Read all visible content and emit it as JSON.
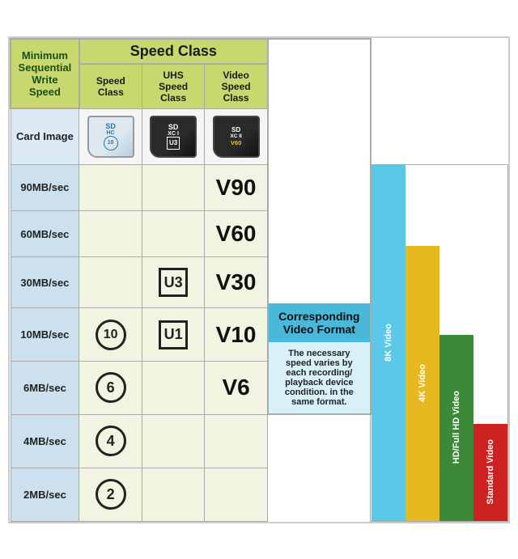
{
  "header": {
    "left_label": "Minimum\nSequential\nWrite Speed",
    "speed_class_label": "Speed Class",
    "speed_class_sub": "Speed\nClass",
    "uhs_sub": "UHS\nSpeed\nClass",
    "video_sub": "Video\nSpeed\nClass",
    "corresponding_video_format": "Corresponding Video Format",
    "video_format_desc": "The necessary speed varies by each recording/ playback device condition. in the same format."
  },
  "card_image_label": "Card Image",
  "cards": [
    {
      "label": "SDHC",
      "type": "sdhc"
    },
    {
      "label": "SDXC I",
      "type": "sdxc"
    },
    {
      "label": "SDXC II",
      "type": "sdxcii"
    }
  ],
  "rows": [
    {
      "speed": "90MB/sec",
      "class": "",
      "uhs": "",
      "video": "V90"
    },
    {
      "speed": "60MB/sec",
      "class": "",
      "uhs": "",
      "video": "V60"
    },
    {
      "speed": "30MB/sec",
      "class": "",
      "uhs": "U3",
      "video": "V30"
    },
    {
      "speed": "10MB/sec",
      "class": "C10",
      "uhs": "U1",
      "video": "V10"
    },
    {
      "speed": "6MB/sec",
      "class": "C6",
      "uhs": "",
      "video": "V6"
    },
    {
      "speed": "4MB/sec",
      "class": "C4",
      "uhs": "",
      "video": ""
    },
    {
      "speed": "2MB/sec",
      "class": "C2",
      "uhs": "",
      "video": ""
    }
  ],
  "video_bars": [
    {
      "label": "8K Video",
      "color": "#5bc8e8"
    },
    {
      "label": "4K Video",
      "color": "#e8b820"
    },
    {
      "label": "HD/Full HD Video",
      "color": "#3a8a3a"
    },
    {
      "label": "Standard Video",
      "color": "#cc2222"
    }
  ]
}
